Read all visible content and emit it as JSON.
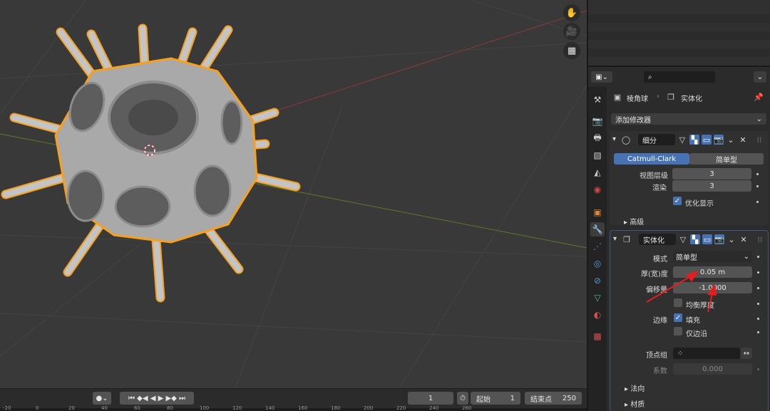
{
  "viewport": {
    "gizmos": [
      {
        "name": "hand-pan-icon",
        "glyph": "✋"
      },
      {
        "name": "camera-icon",
        "glyph": "🎥"
      },
      {
        "name": "grid-view-icon",
        "glyph": "▦"
      }
    ]
  },
  "timeline": {
    "current_frame": "1",
    "start_label": "起始",
    "start_value": "1",
    "end_label": "结束点",
    "end_value": "250",
    "ruler_ticks": [
      "-20",
      "0",
      "20",
      "40",
      "60",
      "80",
      "100",
      "120",
      "140",
      "160",
      "180",
      "200",
      "220",
      "240",
      "260"
    ]
  },
  "properties": {
    "search_placeholder": "",
    "breadcrumb": {
      "object": "棱角球",
      "modifier": "实体化"
    },
    "add_modifier": "添加修改器",
    "subdivision": {
      "name": "细分",
      "tab_catmull": "Catmull-Clark",
      "tab_simple": "简单型",
      "viewport_levels_label": "视图层级",
      "viewport_levels_value": "3",
      "render_label": "渲染",
      "render_value": "3",
      "optimal_display_label": "优化显示",
      "advanced_label": "高级"
    },
    "solidify": {
      "name": "实体化",
      "mode_label": "模式",
      "mode_value": "简单型",
      "thickness_label": "厚(宽)度",
      "thickness_value": "0.05 m",
      "offset_label": "偏移量",
      "offset_value": "-1.0000",
      "even_thickness_label": "均衡厚度",
      "rim_label": "边缘",
      "fill_label": "填充",
      "only_rim_label": "仅边沿",
      "vertex_group_label": "顶点组",
      "factor_label": "系数",
      "factor_value": "0.000",
      "normals_label": "法向",
      "materials_label": "材质"
    }
  },
  "colors": {
    "accent_blue": "#4772b3",
    "selection_orange": "#f5a020",
    "annotation_red": "#e81c1c"
  }
}
